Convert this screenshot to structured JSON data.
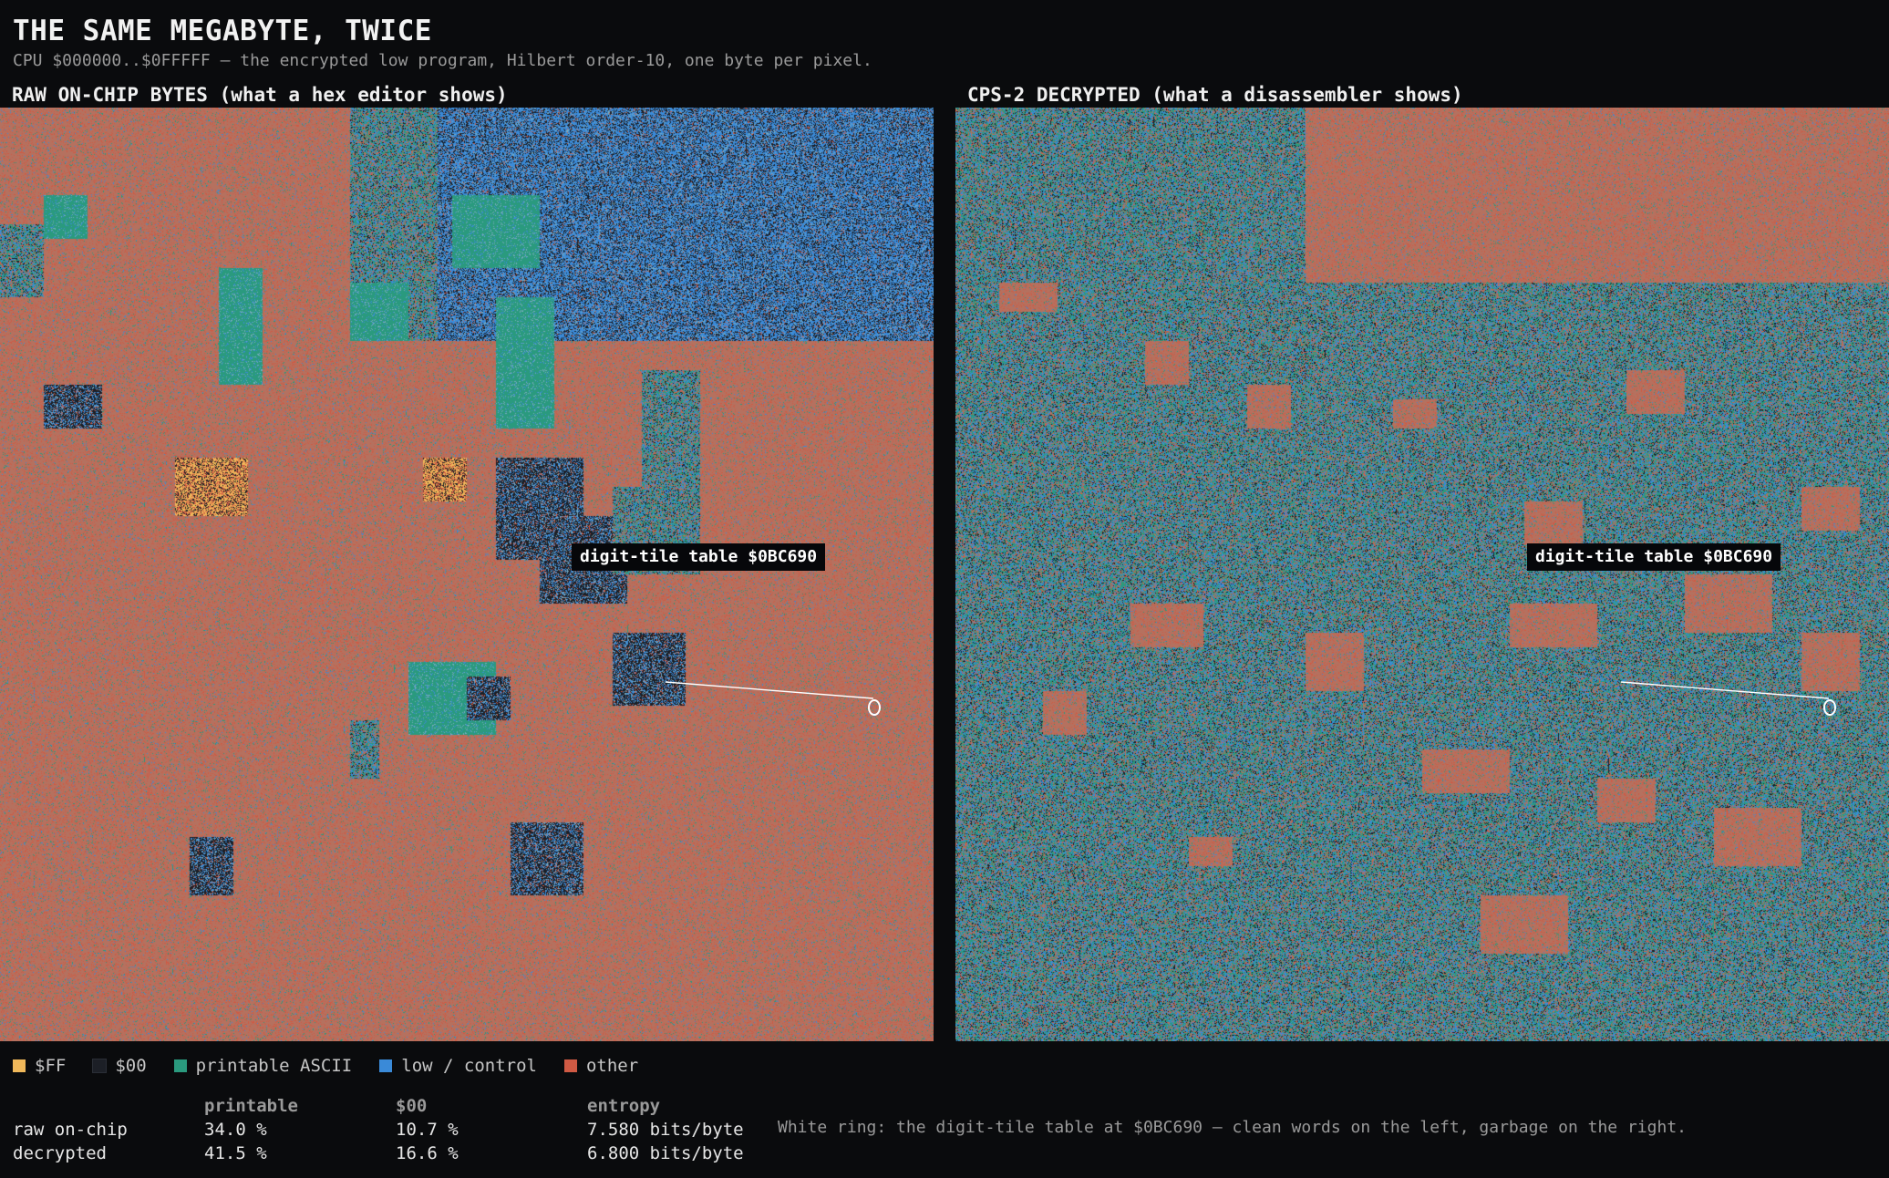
{
  "header": {
    "title": "THE SAME MEGABYTE, TWICE",
    "subtitle": "CPU $000000..$0FFFFF — the encrypted low program, Hilbert order-10, one byte per pixel."
  },
  "panels": [
    {
      "heading": "RAW ON-CHIP BYTES  (what a hex editor shows)",
      "callout": "digit-tile table $0BC690",
      "base_color": "#b5715f"
    },
    {
      "heading": "CPS-2 DECRYPTED  (what a disassembler shows)",
      "callout": "digit-tile table $0BC690",
      "base_color": "#b5715f"
    }
  ],
  "legend": [
    {
      "label": "$FF",
      "color": "#f0b85a"
    },
    {
      "label": "$00",
      "color": "#1c1f26"
    },
    {
      "label": "printable ASCII",
      "color": "#2a9a7e"
    },
    {
      "label": "low / control",
      "color": "#3a8ad8"
    },
    {
      "label": "other",
      "color": "#d05a44"
    }
  ],
  "stats": {
    "headers": [
      "",
      "printable",
      "$00",
      "entropy"
    ],
    "rows": [
      {
        "label": "raw on-chip",
        "printable": "34.0 %",
        "zero": "10.7 %",
        "entropy": "7.580 bits/byte"
      },
      {
        "label": "decrypted",
        "printable": "41.5 %",
        "zero": "16.6 %",
        "entropy": "6.800 bits/byte"
      }
    ]
  },
  "note": "White ring: the digit-tile table at $0BC690 — clean words on the left, garbage on the right."
}
